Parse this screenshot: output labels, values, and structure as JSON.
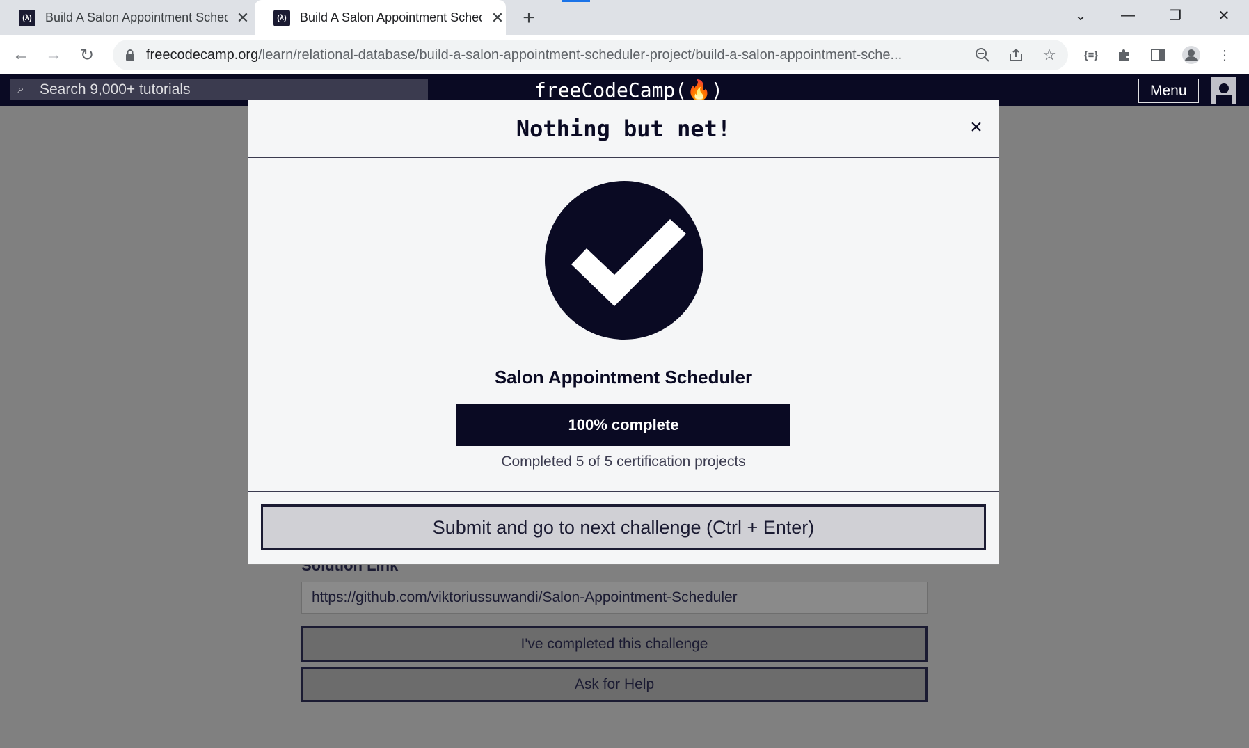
{
  "browser": {
    "tabs": [
      {
        "title": "Build A Salon Appointment Scheduler",
        "favicon": "(λ)"
      },
      {
        "title": "Build A Salon Appointment Scheduler",
        "favicon": "(λ)"
      }
    ],
    "url_host": "freecodecamp.org",
    "url_path": "/learn/relational-database/build-a-salon-appointment-scheduler-project/build-a-salon-appointment-sche..."
  },
  "nav": {
    "search_placeholder": "Search 9,000+ tutorials",
    "logo": "freeCodeCamp(🔥)",
    "menu_label": "Menu"
  },
  "modal": {
    "title": "Nothing but net!",
    "close_symbol": "×",
    "cert_name": "Salon Appointment Scheduler",
    "progress_label": "100% complete",
    "progress_fraction": 1.0,
    "completed_text": "Completed 5 of 5 certification projects",
    "submit_label": "Submit and go to next challenge (Ctrl + Enter)"
  },
  "page": {
    "solution_label": "Solution Link",
    "solution_value": "https://github.com/viktoriussuwandi/Salon-Appointment-Scheduler",
    "completed_button": "I've completed this challenge",
    "help_button": "Ask for Help"
  },
  "colors": {
    "nav_bg": "#0a0a23",
    "modal_bg": "#f5f6f7",
    "overlay": "#808080",
    "accent_dark": "#0a0a23"
  }
}
